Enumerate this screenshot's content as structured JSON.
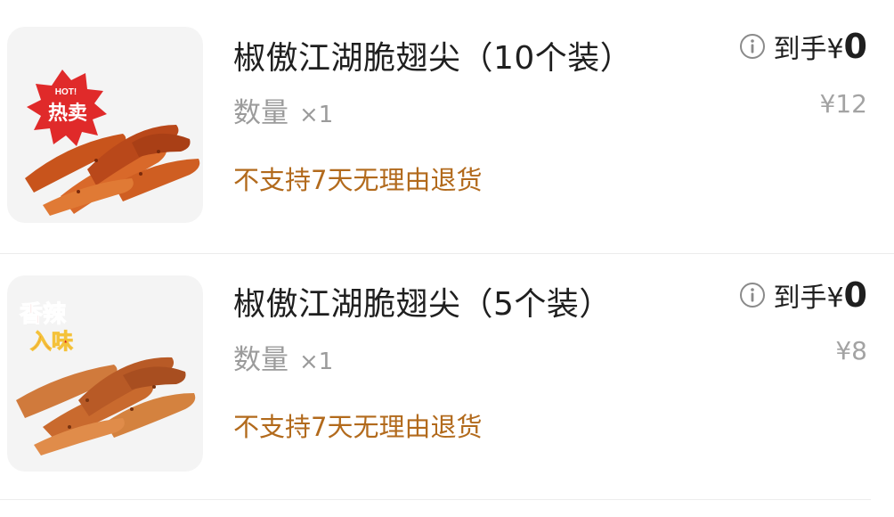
{
  "items": [
    {
      "title": "椒傲江湖脆翅尖（10个装）",
      "qty_label": "数量",
      "qty_value": "×1",
      "final_label": "到手",
      "final_currency": "¥",
      "final_amount": "0",
      "original_price": "¥12",
      "policy": "不支持7天无理由退货",
      "badge_top": "HOT!",
      "badge_text": "热卖",
      "badge_color": "#e02a2a"
    },
    {
      "title": "椒傲江湖脆翅尖（5个装）",
      "qty_label": "数量",
      "qty_value": "×1",
      "final_label": "到手",
      "final_currency": "¥",
      "final_amount": "0",
      "original_price": "¥8",
      "policy": "不支持7天无理由退货",
      "badge_line1": "香辣",
      "badge_line2": "入味",
      "badge_color": "#d8281d"
    }
  ],
  "colors": {
    "title": "#1f1f1f",
    "muted": "#9b9b9b",
    "policy": "#b26a1c"
  }
}
